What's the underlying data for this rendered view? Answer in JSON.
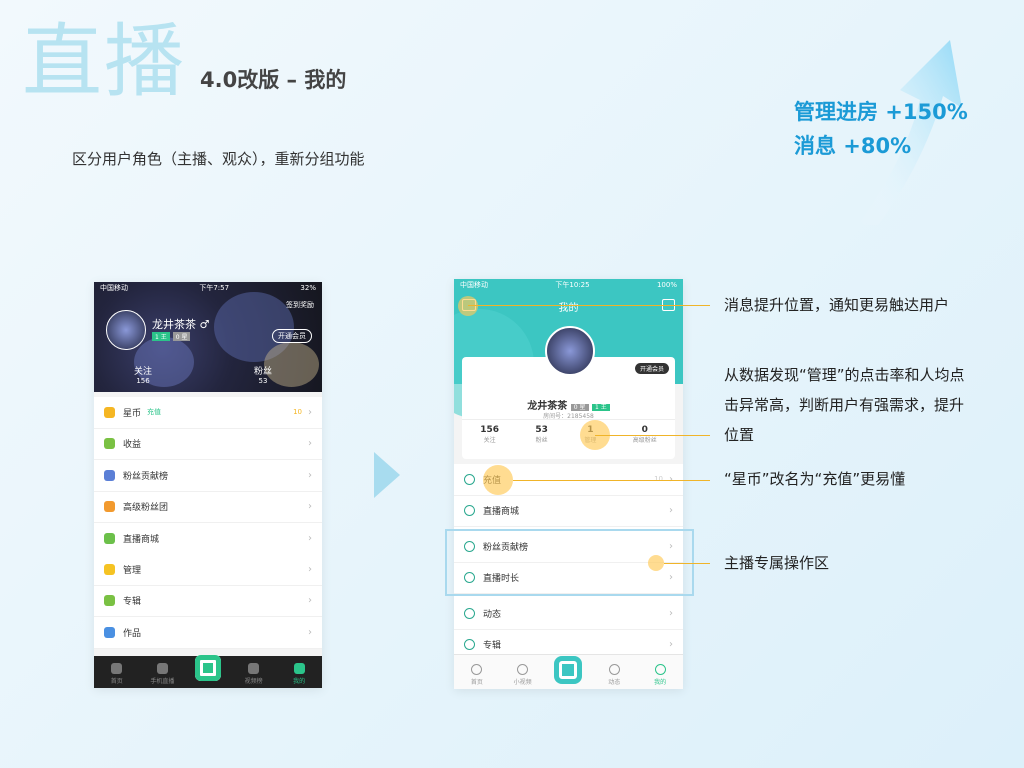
{
  "slide": {
    "title_big": "直播",
    "title_sub": "4.0改版 – 我的",
    "description": "区分用户角色（主播、观众），重新分组功能",
    "stats": [
      "管理进房 +150%",
      "消息 +80%"
    ],
    "colors": {
      "accent": "#1b9ad6",
      "highlight": "#f0b429",
      "teal": "#3cc6c2"
    }
  },
  "phone_old": {
    "status": {
      "carrier": "中国移动",
      "time": "下午7:57",
      "battery": "32%"
    },
    "top_right": "签到奖励",
    "username": "龙井茶茶 ♂",
    "badges": [
      "1 王",
      "0 星"
    ],
    "vip_button": "开通会员",
    "stats": [
      {
        "label": "关注",
        "value": "156"
      },
      {
        "label": "粉丝",
        "value": "53"
      }
    ],
    "menu_group1": [
      {
        "label": "星币",
        "tag": "充值",
        "value": "10",
        "icon": "coin-icon",
        "color": "#f5b623"
      },
      {
        "label": "收益",
        "icon": "leaf-icon",
        "color": "#7ac143"
      },
      {
        "label": "粉丝贡献榜",
        "icon": "trophy-icon",
        "color": "#5b7fd6"
      },
      {
        "label": "高级粉丝团",
        "icon": "shield-icon",
        "color": "#f29a2e"
      },
      {
        "label": "直播商城",
        "icon": "bag-icon",
        "color": "#6cc04a"
      }
    ],
    "menu_group2": [
      {
        "label": "管理",
        "icon": "gift-icon",
        "color": "#f5c323"
      },
      {
        "label": "专辑",
        "icon": "album-icon",
        "color": "#7ac143"
      },
      {
        "label": "作品",
        "icon": "video-icon",
        "color": "#4a90e2"
      }
    ],
    "tabs": [
      "首页",
      "手机直播",
      "",
      "视频榜",
      "我的"
    ]
  },
  "phone_new": {
    "status": {
      "carrier": "中国移动",
      "time": "下午10:25",
      "battery": "100%"
    },
    "page_title": "我的",
    "username": "龙井茶茶",
    "badges": [
      "0 星",
      "1 王"
    ],
    "room_id": "房间号：2185458",
    "vip_button": "开通会员",
    "stats": [
      {
        "value": "156",
        "label": "关注"
      },
      {
        "value": "53",
        "label": "粉丝"
      },
      {
        "value": "1",
        "label": "管理"
      },
      {
        "value": "0",
        "label": "高级粉丝"
      }
    ],
    "menu": [
      {
        "label": "充值",
        "value": "10",
        "icon": "coin-icon"
      },
      {
        "label": "直播商城",
        "icon": "store-icon"
      },
      {
        "label": "粉丝贡献榜",
        "icon": "medal-icon"
      },
      {
        "label": "直播时长",
        "icon": "edit-icon"
      },
      {
        "label": "动态",
        "icon": "planet-icon"
      },
      {
        "label": "专辑",
        "icon": "disc-icon"
      }
    ],
    "tabs": [
      "首页",
      "小视频",
      "",
      "动态",
      "我的"
    ]
  },
  "annotations": [
    "消息提升位置，通知更易触达用户",
    "从数据发现“管理”的点击率和人均点击异常高，判断用户有强需求，提升位置",
    "“星币”改名为“充值”更易懂",
    "主播专属操作区"
  ]
}
